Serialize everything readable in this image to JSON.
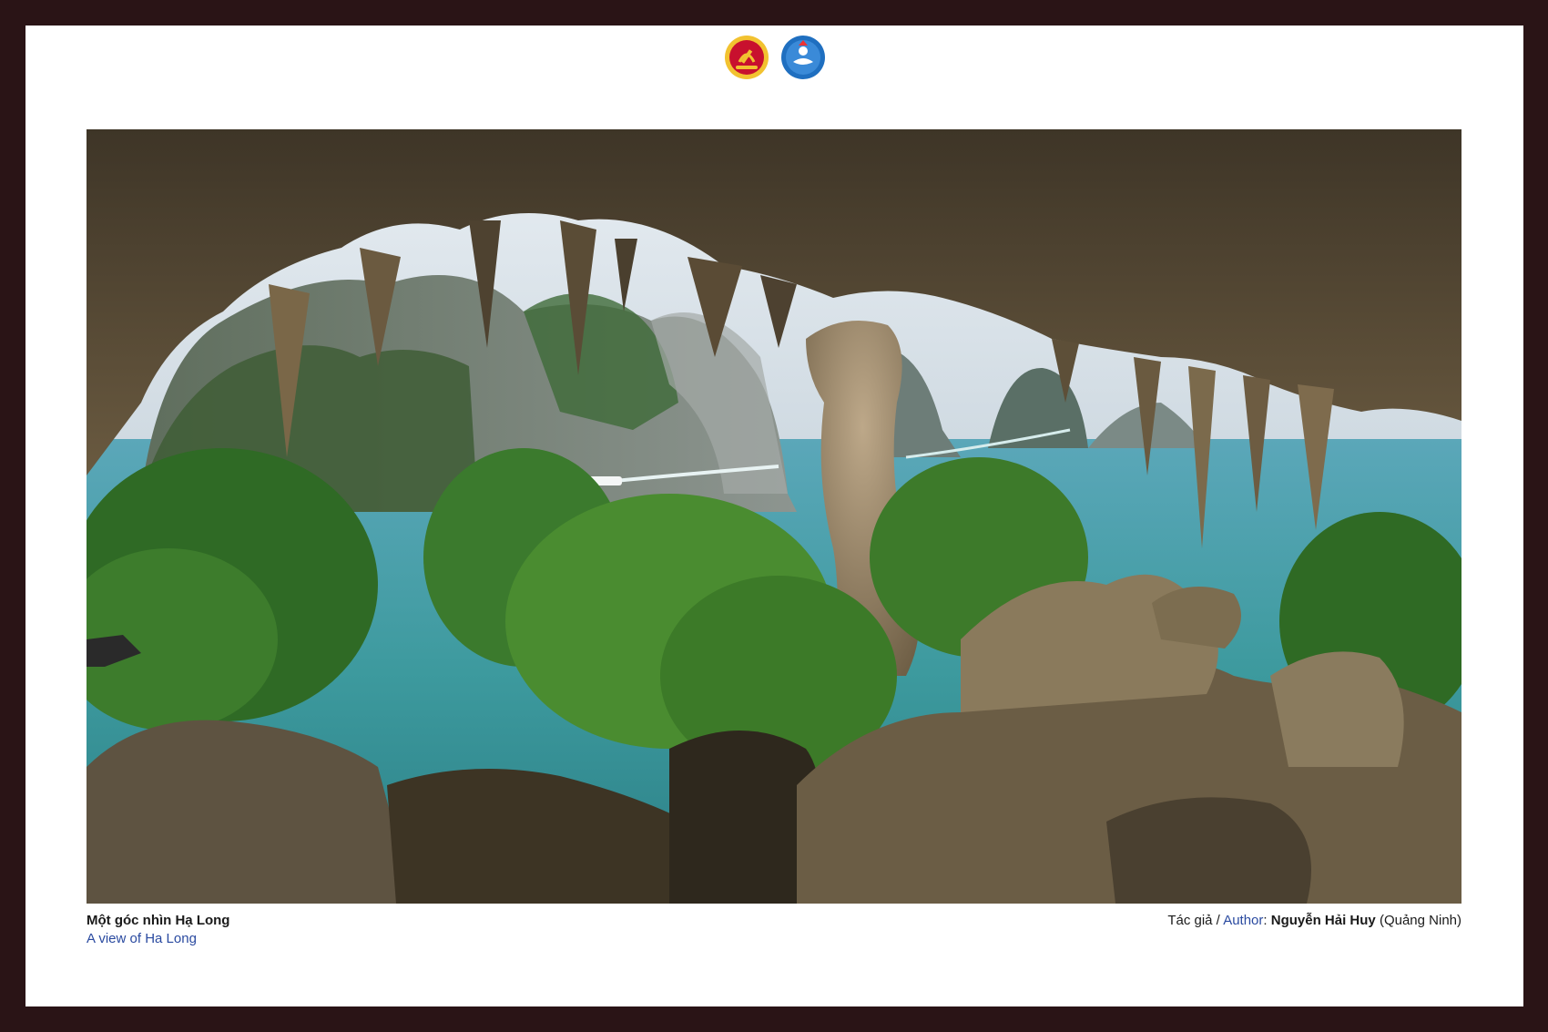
{
  "logos": [
    {
      "icon": "party-emblem-icon",
      "color": "#c8102e"
    },
    {
      "icon": "union-emblem-icon",
      "color": "#1f6fc0"
    }
  ],
  "photo": {
    "subject": "cave-view-icon"
  },
  "caption": {
    "title_vi": "Một góc nhìn Hạ Long",
    "title_en": "A view of Ha Long",
    "author_label_vi": "Tác giả / ",
    "author_label_en": "Author",
    "author_colon": ": ",
    "author_name": "Nguyễn Hải Huy",
    "author_location": "(Quảng Ninh)"
  },
  "colors": {
    "frame": "#2a1416",
    "accent_blue": "#2a4aa0"
  }
}
